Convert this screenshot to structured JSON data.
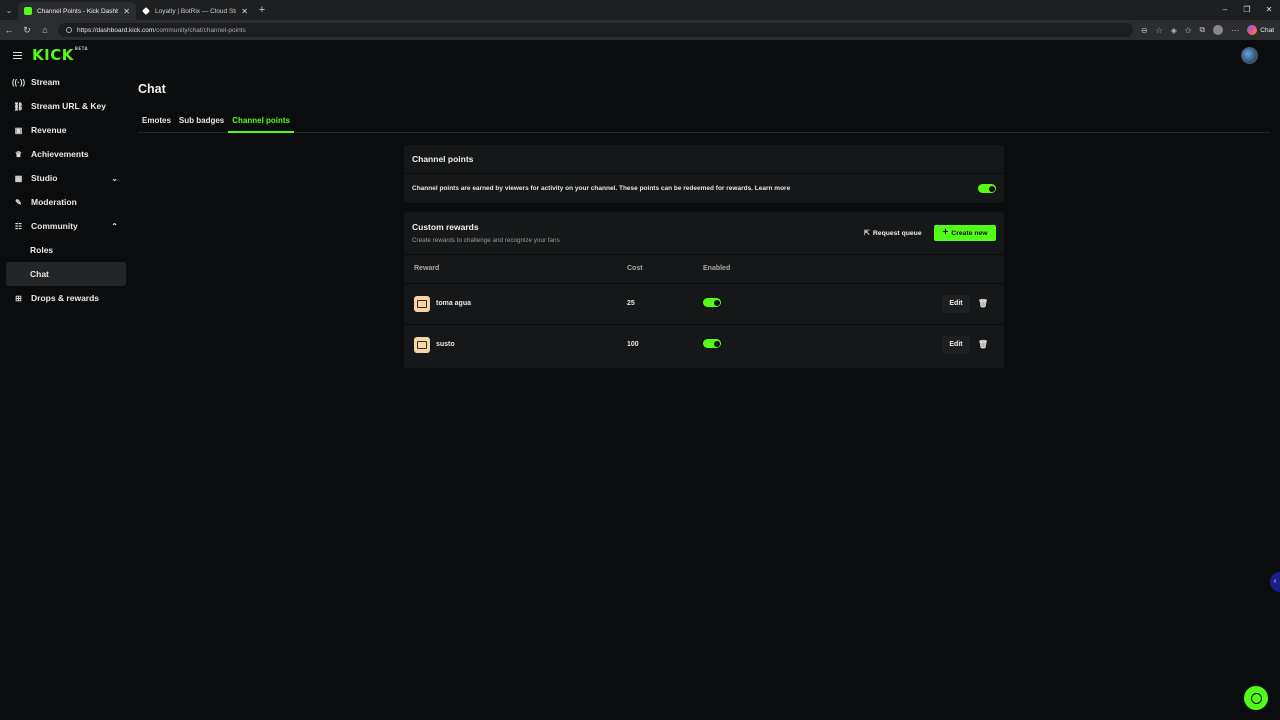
{
  "browser": {
    "tabs": [
      {
        "title": "Channel Points - Kick Dashboard",
        "active": true
      },
      {
        "title": "Loyalty | BotRix — Cloud Streaming",
        "active": false
      }
    ],
    "url_host": "https://dashboard.kick.com",
    "url_path": "/community/chat/channel-points",
    "chat_label": "Chat"
  },
  "brand": {
    "logo": "KICK",
    "logo_sup": "BETA",
    "accent": "#53fc18"
  },
  "sidebar": {
    "items": [
      {
        "label": "Stream",
        "icon": "broadcast-icon"
      },
      {
        "label": "Stream URL & Key",
        "icon": "link-icon"
      },
      {
        "label": "Revenue",
        "icon": "revenue-icon"
      },
      {
        "label": "Achievements",
        "icon": "trophy-icon"
      },
      {
        "label": "Studio",
        "icon": "studio-icon"
      },
      {
        "label": "Moderation",
        "icon": "wrench-icon"
      },
      {
        "label": "Community",
        "icon": "community-icon"
      }
    ],
    "community_sub": [
      {
        "label": "Roles"
      },
      {
        "label": "Chat"
      }
    ],
    "drops": {
      "label": "Drops & rewards",
      "icon": "drops-icon"
    }
  },
  "page": {
    "title": "Chat",
    "tabs": [
      "Emotes",
      "Sub badges",
      "Channel points"
    ],
    "active_tab": "Channel points"
  },
  "channel_points": {
    "title": "Channel points",
    "description": "Channel points are earned by viewers for activity on your channel. These points can be redeemed for rewards. Learn more",
    "enabled": true
  },
  "custom_rewards": {
    "title": "Custom rewards",
    "description": "Create rewards to challenge and recognize your fans",
    "request_queue_label": "Request queue",
    "create_label": "Create new",
    "columns": [
      "Reward",
      "Cost",
      "Enabled"
    ],
    "rows": [
      {
        "name": "toma agua",
        "cost": "25",
        "enabled": true,
        "edit_label": "Edit"
      },
      {
        "name": "susto",
        "cost": "100",
        "enabled": true,
        "edit_label": "Edit"
      }
    ]
  }
}
